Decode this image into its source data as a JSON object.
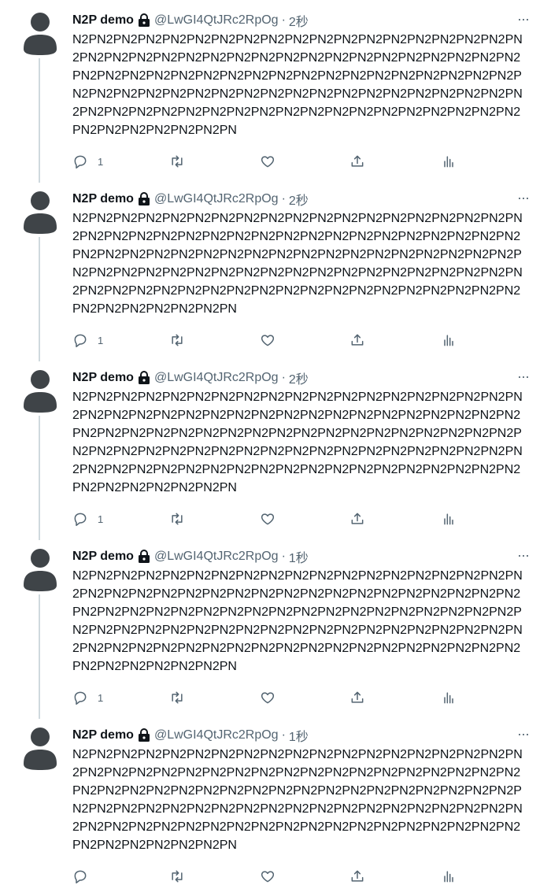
{
  "tweets": [
    {
      "name": "N2P demo",
      "handle": "@LwGI4QtJRc2RpOg",
      "separator": "·",
      "time": "2秒",
      "text": "N2PN2PN2PN2PN2PN2PN2PN2PN2PN2PN2PN2PN2PN2PN2PN2PN2PN2PN\n2PN2PN2PN2PN2PN2PN2PN2PN2PN2PN2PN2PN2PN2PN2PN2PN2PN2PN2\nPN2PN2PN2PN2PN2PN2PN2PN2PN2PN2PN2PN2PN2PN2PN2PN2PN2PN2P\nN2PN2PN2PN2PN2PN2PN2PN2PN2PN2PN2PN2PN2PN2PN2PN2PN2PN2PN\n2PN2PN2PN2PN2PN2PN2PN2PN2PN2PN2PN2PN2PN2PN2PN2PN2PN2PN2\nPN2PN2PN2PN2PN2PN2PN",
      "reply_count": "1",
      "more": "···"
    },
    {
      "name": "N2P demo",
      "handle": "@LwGI4QtJRc2RpOg",
      "separator": "·",
      "time": "2秒",
      "text": "N2PN2PN2PN2PN2PN2PN2PN2PN2PN2PN2PN2PN2PN2PN2PN2PN2PN2PN\n2PN2PN2PN2PN2PN2PN2PN2PN2PN2PN2PN2PN2PN2PN2PN2PN2PN2PN2\nPN2PN2PN2PN2PN2PN2PN2PN2PN2PN2PN2PN2PN2PN2PN2PN2PN2PN2P\nN2PN2PN2PN2PN2PN2PN2PN2PN2PN2PN2PN2PN2PN2PN2PN2PN2PN2PN\n2PN2PN2PN2PN2PN2PN2PN2PN2PN2PN2PN2PN2PN2PN2PN2PN2PN2PN2\nPN2PN2PN2PN2PN2PN2PN",
      "reply_count": "1",
      "more": "···"
    },
    {
      "name": "N2P demo",
      "handle": "@LwGI4QtJRc2RpOg",
      "separator": "·",
      "time": "2秒",
      "text": "N2PN2PN2PN2PN2PN2PN2PN2PN2PN2PN2PN2PN2PN2PN2PN2PN2PN2PN\n2PN2PN2PN2PN2PN2PN2PN2PN2PN2PN2PN2PN2PN2PN2PN2PN2PN2PN2\nPN2PN2PN2PN2PN2PN2PN2PN2PN2PN2PN2PN2PN2PN2PN2PN2PN2PN2P\nN2PN2PN2PN2PN2PN2PN2PN2PN2PN2PN2PN2PN2PN2PN2PN2PN2PN2PN\n2PN2PN2PN2PN2PN2PN2PN2PN2PN2PN2PN2PN2PN2PN2PN2PN2PN2PN2\nPN2PN2PN2PN2PN2PN2PN",
      "reply_count": "1",
      "more": "···"
    },
    {
      "name": "N2P demo",
      "handle": "@LwGI4QtJRc2RpOg",
      "separator": "·",
      "time": "1秒",
      "text": "N2PN2PN2PN2PN2PN2PN2PN2PN2PN2PN2PN2PN2PN2PN2PN2PN2PN2PN\n2PN2PN2PN2PN2PN2PN2PN2PN2PN2PN2PN2PN2PN2PN2PN2PN2PN2PN2\nPN2PN2PN2PN2PN2PN2PN2PN2PN2PN2PN2PN2PN2PN2PN2PN2PN2PN2P\nN2PN2PN2PN2PN2PN2PN2PN2PN2PN2PN2PN2PN2PN2PN2PN2PN2PN2PN\n2PN2PN2PN2PN2PN2PN2PN2PN2PN2PN2PN2PN2PN2PN2PN2PN2PN2PN2\nPN2PN2PN2PN2PN2PN2PN",
      "reply_count": "1",
      "more": "···"
    },
    {
      "name": "N2P demo",
      "handle": "@LwGI4QtJRc2RpOg",
      "separator": "·",
      "time": "1秒",
      "text": "N2PN2PN2PN2PN2PN2PN2PN2PN2PN2PN2PN2PN2PN2PN2PN2PN2PN2PN\n2PN2PN2PN2PN2PN2PN2PN2PN2PN2PN2PN2PN2PN2PN2PN2PN2PN2PN2\nPN2PN2PN2PN2PN2PN2PN2PN2PN2PN2PN2PN2PN2PN2PN2PN2PN2PN2P\nN2PN2PN2PN2PN2PN2PN2PN2PN2PN2PN2PN2PN2PN2PN2PN2PN2PN2PN\n2PN2PN2PN2PN2PN2PN2PN2PN2PN2PN2PN2PN2PN2PN2PN2PN2PN2PN2\nPN2PN2PN2PN2PN2PN2PN",
      "reply_count": "",
      "more": "···"
    }
  ],
  "icons": {
    "avatar": "default-avatar-icon",
    "lock": "lock-icon",
    "more": "more-icon",
    "reply": "reply-icon",
    "retweet": "retweet-icon",
    "like": "like-icon",
    "share": "share-icon",
    "analytics": "analytics-icon"
  },
  "colors": {
    "text": "#0f1419",
    "secondary": "#536471",
    "avatar": "#3f4448",
    "thread_line": "#cfd9de"
  }
}
